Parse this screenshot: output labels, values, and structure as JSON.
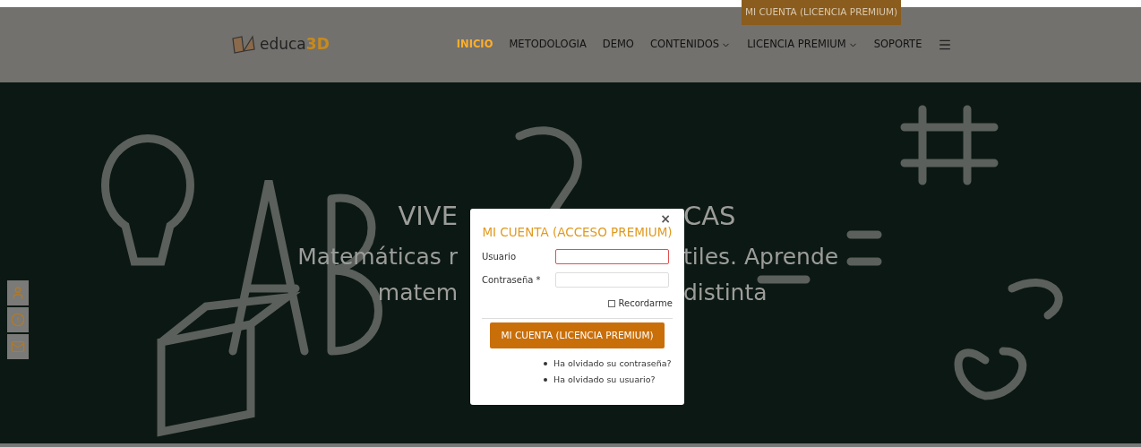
{
  "top_button": "MI CUENTA (LICENCIA PREMIUM)",
  "logo": {
    "text": "educa",
    "accent": "3D"
  },
  "nav": [
    {
      "label": "INICIO",
      "selected": true,
      "dropdown": false
    },
    {
      "label": "METODOLOGIA",
      "selected": false,
      "dropdown": false
    },
    {
      "label": "DEMO",
      "selected": false,
      "dropdown": false
    },
    {
      "label": "CONTENIDOS",
      "selected": false,
      "dropdown": true
    },
    {
      "label": "LICENCIA PREMIUM",
      "selected": false,
      "dropdown": true
    },
    {
      "label": "SOPORTE",
      "selected": false,
      "dropdown": false
    }
  ],
  "hero": {
    "lines": [
      {
        "left": "VIVE",
        "right": "CAS",
        "kind": "title"
      },
      {
        "left": "Matemáticas r",
        "right": "tiles. Aprende",
        "kind": "text"
      },
      {
        "left": "matem",
        "right": "distinta",
        "kind": "text"
      }
    ]
  },
  "side_icons": [
    {
      "kind": "user"
    },
    {
      "kind": "alert"
    },
    {
      "kind": "mail"
    }
  ],
  "modal": {
    "title": "MI CUENTA (ACCESO PREMIUM)",
    "close": "×",
    "fields": [
      {
        "label": "Usuario",
        "error": true
      },
      {
        "label": "Contraseña *",
        "error": false
      }
    ],
    "remember": {
      "label": "Recordarme",
      "checked": false
    },
    "submit": "MI CUENTA (LICENCIA PREMIUM)",
    "links": [
      "Ha olvidado su contraseña?",
      "Ha olvidado su usuario?"
    ]
  }
}
